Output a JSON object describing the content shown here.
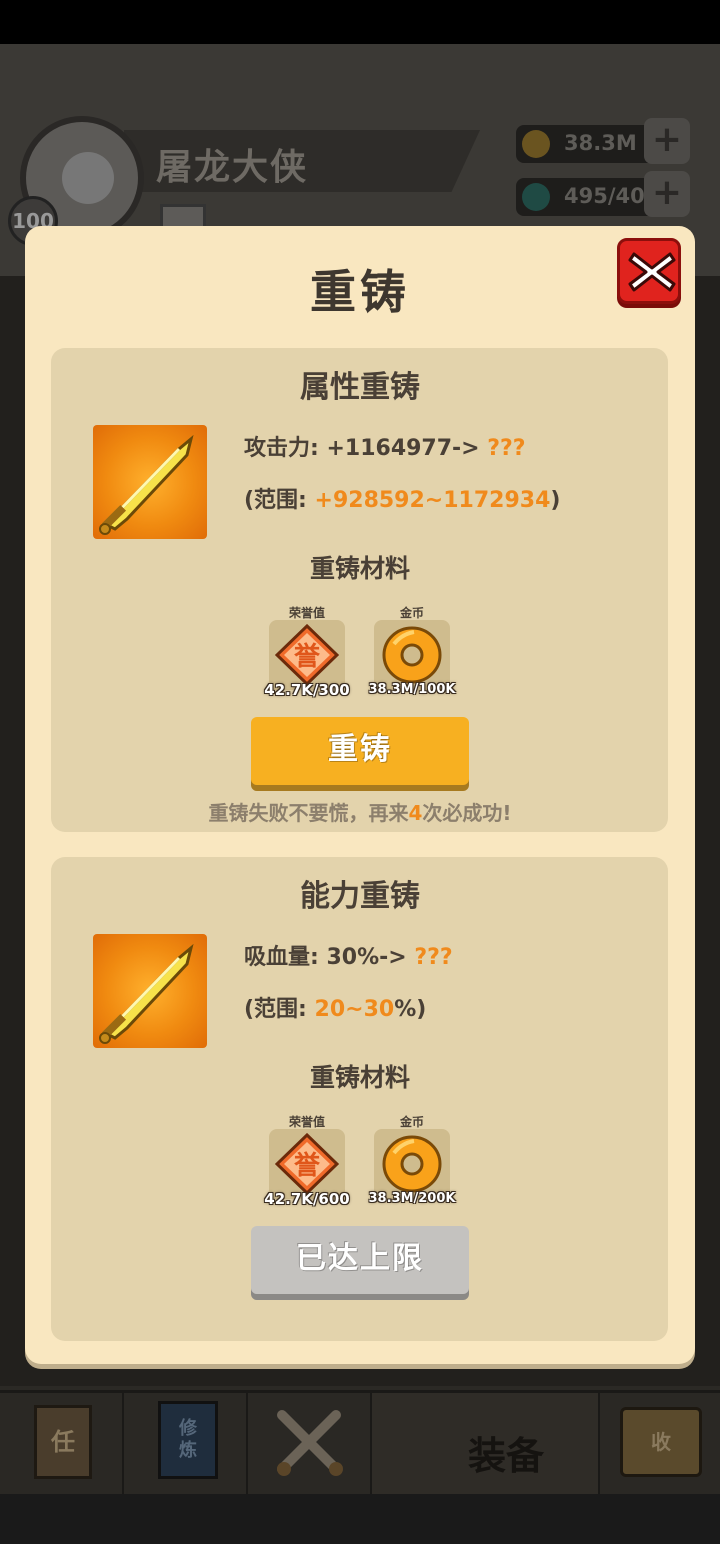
{
  "background": {
    "player_name": "屠龙大侠",
    "player_level": "100",
    "gold": "38.3M",
    "gems": "495/40",
    "tabs": [
      {
        "name": "quest",
        "label": "任"
      },
      {
        "name": "cultivate",
        "label": "修\n炼"
      },
      {
        "name": "battle",
        "label": ""
      },
      {
        "name": "equipment",
        "label": "装备"
      },
      {
        "name": "collect",
        "label": "收"
      }
    ]
  },
  "modal": {
    "title": "重铸",
    "close_icon": "close-x-icon",
    "attribute_panel": {
      "title": "属性重铸",
      "stat_label": "攻击力: +1164977->",
      "stat_unknown": "???",
      "range_prefix": "(范围: ",
      "range_value": "+928592~1172934",
      "range_suffix": ")",
      "materials_title": "重铸材料",
      "materials": [
        {
          "label": "荣誉值",
          "icon": "honor-badge-icon",
          "count": "42.7K/300"
        },
        {
          "label": "金币",
          "icon": "gold-coin-icon",
          "count": "38.3M/100K"
        }
      ],
      "button_label": "重铸",
      "hint_prefix": "重铸失败不要慌，再来",
      "hint_number": "4",
      "hint_suffix": "次必成功!"
    },
    "ability_panel": {
      "title": "能力重铸",
      "stat_label": "吸血量: 30%->",
      "stat_unknown": "???",
      "range_prefix": "(范围: ",
      "range_value": "20~30",
      "range_suffix": "%)",
      "materials_title": "重铸材料",
      "materials": [
        {
          "label": "荣誉值",
          "icon": "honor-badge-icon",
          "count": "42.7K/600"
        },
        {
          "label": "金币",
          "icon": "gold-coin-icon",
          "count": "38.3M/200K"
        }
      ],
      "button_label": "已达上限"
    }
  },
  "colors": {
    "panel_bg": "#f9e7c0",
    "section_bg": "#e3d3ac",
    "accent_orange": "#f08a1c",
    "button_orange": "#f7b021",
    "button_disabled": "#c4c2bf",
    "close_red": "#e0231e"
  }
}
